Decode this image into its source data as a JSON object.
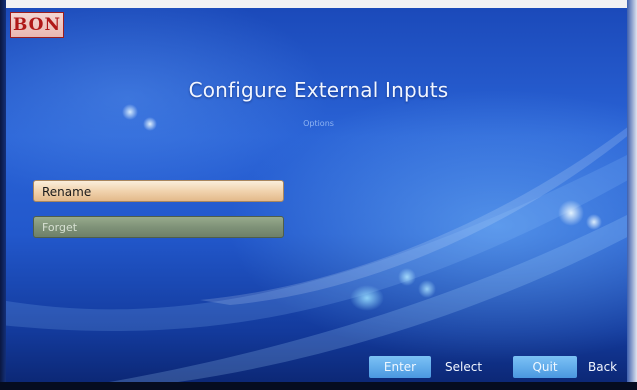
{
  "brand": {
    "logo_text": "BON"
  },
  "header": {
    "title": "Configure External Inputs",
    "subtitle": "Options"
  },
  "menu": {
    "items": [
      {
        "label": "Rename",
        "state": "selected"
      },
      {
        "label": "Forget",
        "state": "disabled"
      }
    ]
  },
  "footer": {
    "hints": [
      {
        "key": "Enter",
        "action": "Select"
      },
      {
        "key": "Quit",
        "action": "Back"
      }
    ]
  },
  "colors": {
    "background": "#2258cc",
    "selected_item": "#f1d3ae",
    "disabled_item": "#7f9278",
    "key_button": "#4a97e0",
    "logo_text": "#b01818"
  }
}
